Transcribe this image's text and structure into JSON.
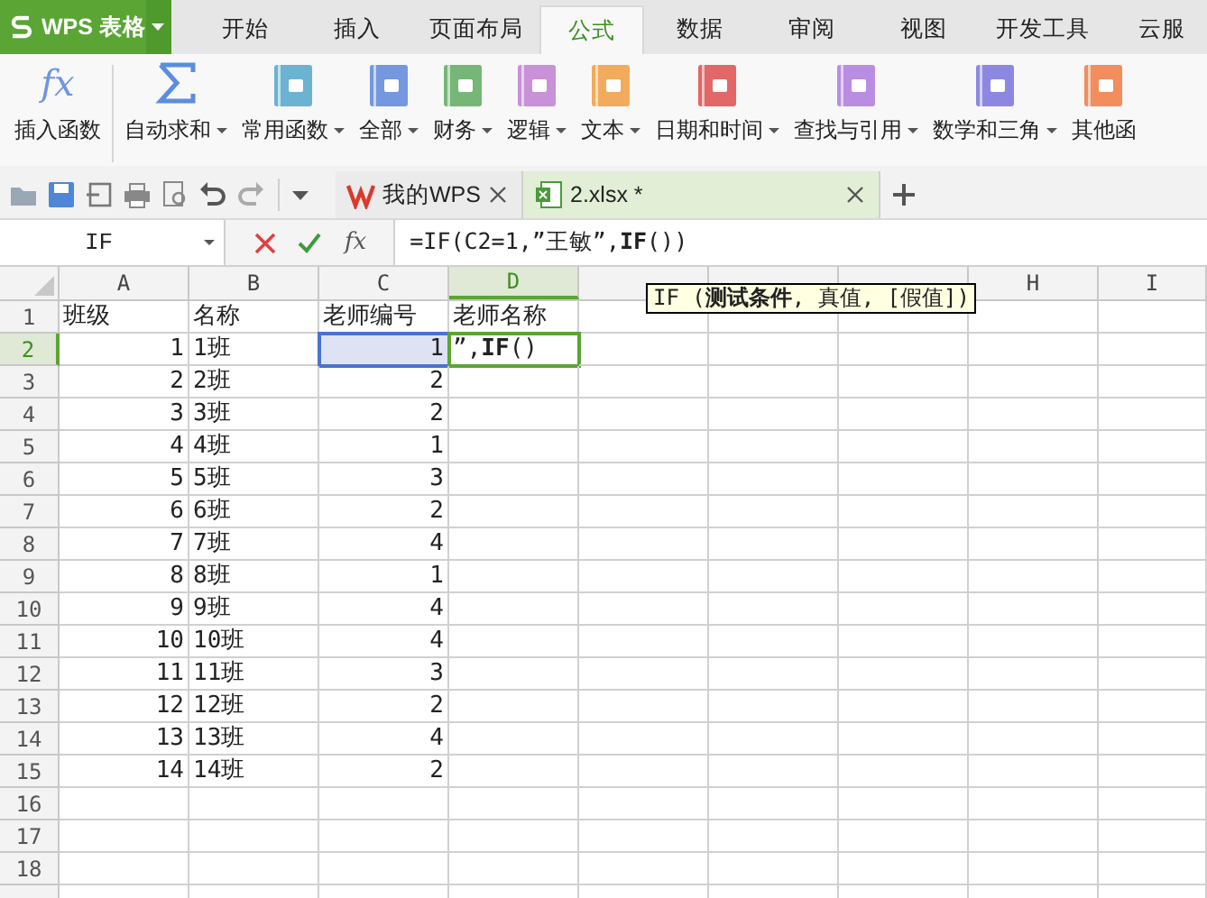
{
  "app_menu": {
    "label": "WPS 表格"
  },
  "tabs": [
    {
      "label": "开始",
      "selected": false
    },
    {
      "label": "插入",
      "selected": false
    },
    {
      "label": "页面布局",
      "selected": false
    },
    {
      "label": "公式",
      "selected": true
    },
    {
      "label": "数据",
      "selected": false
    },
    {
      "label": "审阅",
      "selected": false
    },
    {
      "label": "视图",
      "selected": false
    },
    {
      "label": "开发工具",
      "selected": false
    },
    {
      "label": "云服",
      "selected": false
    }
  ],
  "ribbon": [
    {
      "kind": "fx",
      "icon_text": "fx",
      "label": "插入函数",
      "dropdown": false
    },
    {
      "kind": "sum",
      "label": "自动求和",
      "dropdown": true
    },
    {
      "kind": "book",
      "label": "常用函数",
      "dropdown": true,
      "color": "#6bb3d0"
    },
    {
      "kind": "book",
      "label": "全部",
      "dropdown": true,
      "color": "#7398e0"
    },
    {
      "kind": "book",
      "label": "财务",
      "dropdown": true,
      "color": "#76b676"
    },
    {
      "kind": "book",
      "label": "逻辑",
      "dropdown": true,
      "color": "#c891d8"
    },
    {
      "kind": "book",
      "label": "文本",
      "dropdown": true,
      "color": "#f2ab5c"
    },
    {
      "kind": "book",
      "label": "日期和时间",
      "dropdown": true,
      "color": "#e26767"
    },
    {
      "kind": "book",
      "label": "查找与引用",
      "dropdown": true,
      "color": "#b98de2"
    },
    {
      "kind": "book",
      "label": "数学和三角",
      "dropdown": true,
      "color": "#8c88e2"
    },
    {
      "kind": "book",
      "label": "其他函",
      "dropdown": false,
      "color": "#f28d5e"
    }
  ],
  "doc_tabs": [
    {
      "kind": "wps",
      "label": "我的WPS",
      "selected": false
    },
    {
      "kind": "sheet",
      "label": "2.xlsx *",
      "selected": true
    }
  ],
  "formula_bar": {
    "name_box": "IF",
    "function_button": "fx",
    "formula": "=IF(C2=1,”王敏”,**IF**())"
  },
  "tooltip": "IF (**测试条件**, 真值, [假值])",
  "grid": {
    "columns": [
      {
        "label": "A",
        "selected": false
      },
      {
        "label": "B",
        "selected": false
      },
      {
        "label": "C",
        "selected": false
      },
      {
        "label": "D",
        "selected": true
      },
      {
        "selected": false
      },
      {
        "selected": false
      },
      {
        "selected": false
      },
      {
        "label": "H",
        "selected": false
      },
      {
        "label": "I",
        "selected": false
      }
    ],
    "rows": [
      {
        "label": "1",
        "kind": "header",
        "selected": false,
        "cells": [
          "班级",
          "名称",
          "老师编号",
          "老师名称"
        ]
      },
      {
        "label": "2",
        "selected": true,
        "cells": [
          "1",
          "1班",
          {
            "text": "1",
            "referenced": true,
            "active": false
          },
          {
            "text": "”,**IF**()",
            "referenced": false,
            "active": true
          }
        ]
      },
      {
        "label": "3",
        "selected": false,
        "cells": [
          "2",
          "2班",
          "2"
        ]
      },
      {
        "label": "4",
        "selected": false,
        "cells": [
          "3",
          "3班",
          "2"
        ]
      },
      {
        "label": "5",
        "selected": false,
        "cells": [
          "4",
          "4班",
          "1"
        ]
      },
      {
        "label": "6",
        "selected": false,
        "cells": [
          "5",
          "5班",
          "3"
        ]
      },
      {
        "label": "7",
        "selected": false,
        "cells": [
          "6",
          "6班",
          "2"
        ]
      },
      {
        "label": "8",
        "selected": false,
        "cells": [
          "7",
          "7班",
          "4"
        ]
      },
      {
        "label": "9",
        "selected": false,
        "cells": [
          "8",
          "8班",
          "1"
        ]
      },
      {
        "label": "10",
        "selected": false,
        "cells": [
          "9",
          "9班",
          "4"
        ]
      },
      {
        "label": "11",
        "selected": false,
        "cells": [
          "10",
          "10班",
          "4"
        ]
      },
      {
        "label": "12",
        "selected": false,
        "cells": [
          "11",
          "11班",
          "3"
        ]
      },
      {
        "label": "13",
        "selected": false,
        "cells": [
          "12",
          "12班",
          "2"
        ]
      },
      {
        "label": "14",
        "selected": false,
        "cells": [
          "13",
          "13班",
          "4"
        ]
      },
      {
        "label": "15",
        "selected": false,
        "cells": [
          "14",
          "14班",
          "2"
        ]
      },
      {
        "label": "16",
        "selected": false,
        "cells": []
      },
      {
        "label": "17",
        "selected": false,
        "cells": []
      },
      {
        "label": "18",
        "selected": false,
        "cells": []
      },
      {
        "selected": false,
        "cells": []
      }
    ]
  }
}
